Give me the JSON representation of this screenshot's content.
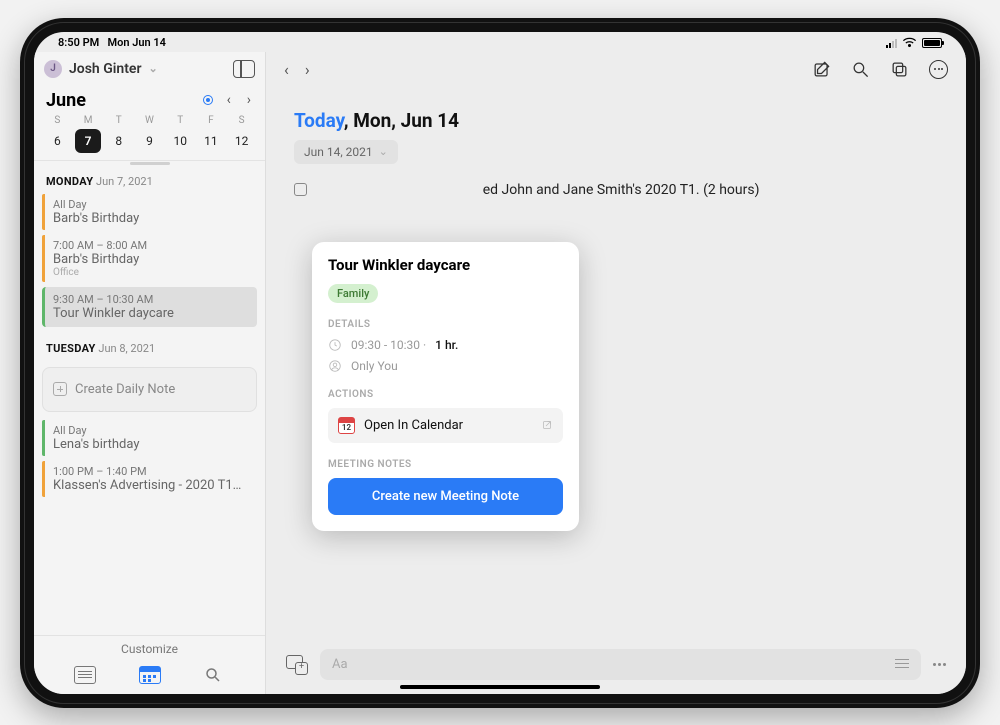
{
  "status": {
    "time": "8:50 PM",
    "date": "Mon Jun 14"
  },
  "user": {
    "initial": "J",
    "name": "Josh Ginter"
  },
  "month": {
    "name": "June",
    "weekhead": [
      "S",
      "M",
      "T",
      "W",
      "T",
      "F",
      "S"
    ],
    "days": [
      "6",
      "7",
      "8",
      "9",
      "10",
      "11",
      "12"
    ],
    "selected_index": 1
  },
  "days": [
    {
      "label_bold": "MONDAY",
      "label_date": "Jun 7, 2021",
      "events": [
        {
          "time": "All Day",
          "name": "Barb's Birthday",
          "color": "orange"
        },
        {
          "time": "7:00 AM – 8:00 AM",
          "name": "Barb's Birthday",
          "loc": "Office",
          "color": "orange"
        },
        {
          "time": "9:30 AM – 10:30 AM",
          "name": "Tour Winkler daycare",
          "color": "green",
          "selected": true
        }
      ]
    },
    {
      "label_bold": "TUESDAY",
      "label_date": "Jun 8, 2021",
      "create_note": "Create Daily Note",
      "events": [
        {
          "time": "All Day",
          "name": "Lena's birthday",
          "color": "green"
        },
        {
          "time": "1:00 PM – 1:40 PM",
          "name": "Klassen's Advertising - 2020 T1…",
          "color": "orange"
        }
      ]
    }
  ],
  "sidebar_bottom": {
    "customize": "Customize"
  },
  "main": {
    "today_label": "Today",
    "date_rest": ", Mon, Jun 14",
    "chip": "Jun 14, 2021",
    "row_text_fragment": "ed John and Jane Smith's 2020 T1. (2 hours)",
    "input_placeholder": "Aa"
  },
  "pop": {
    "title": "Tour Winkler daycare",
    "tag": "Family",
    "sect_details": "DETAILS",
    "time_range": "09:30 - 10:30 ·",
    "duration": "1 hr.",
    "visibility": "Only You",
    "sect_actions": "ACTIONS",
    "open_cal": "Open In Calendar",
    "cal_day": "12",
    "sect_notes": "MEETING NOTES",
    "create_note": "Create new Meeting Note"
  }
}
